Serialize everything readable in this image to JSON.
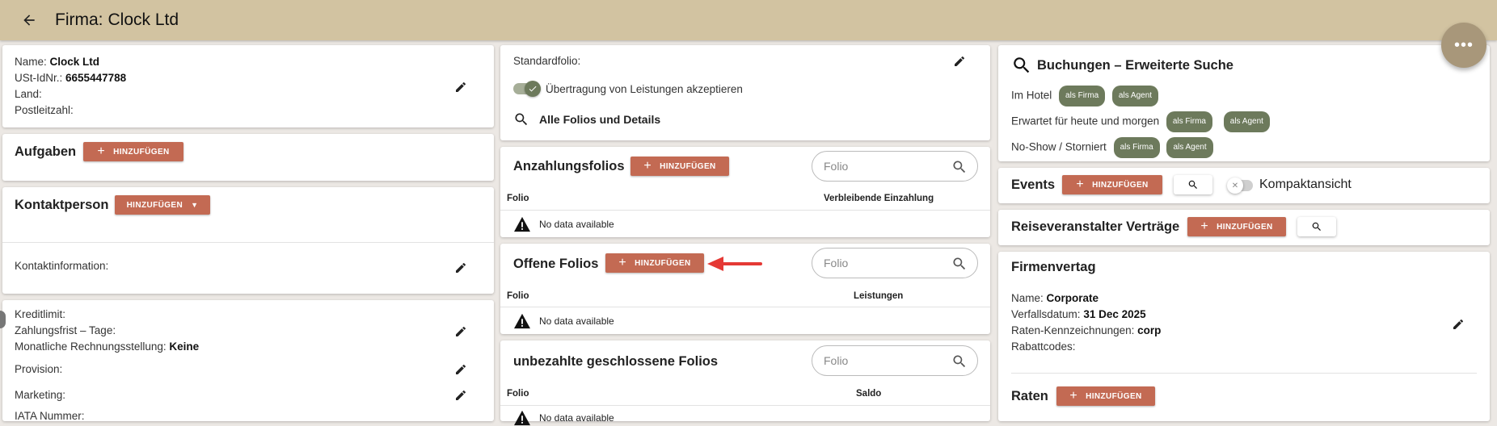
{
  "header": {
    "title_label": "Firma:",
    "title_value": "Clock Ltd"
  },
  "company": {
    "name_label": "Name:",
    "name_value": "Clock Ltd",
    "vat_label": "USt-IdNr.:",
    "vat_value": "6655447788",
    "country_label": "Land:",
    "postal_label": "Postleitzahl:"
  },
  "tasks": {
    "title": "Aufgaben",
    "add_label": "HINZUFÜGEN"
  },
  "contact": {
    "title": "Kontaktperson",
    "add_label": "HINZUFÜGEN",
    "info_label": "Kontaktinformation:"
  },
  "credit": {
    "limit_label": "Kreditlimit:",
    "payment_terms_label": "Zahlungsfrist – Tage:",
    "monthly_billing_label": "Monatliche Rechnungsstellung:",
    "monthly_billing_value": "Keine",
    "commission_label": "Provision:",
    "marketing_label": "Marketing:",
    "iata_label": "IATA Nummer:"
  },
  "standard": {
    "folio_label": "Standardfolio:",
    "toggle_label": "Übertragung von Leistungen akzeptieren",
    "toggle_on": true,
    "all_folios_label": "Alle Folios und Details"
  },
  "deposit": {
    "title": "Anzahlungsfolios",
    "add_label": "HINZUFÜGEN",
    "search_placeholder": "Folio",
    "col1": "Folio",
    "col2": "Verbleibende Einzahlung",
    "empty": "No data available"
  },
  "open_folios": {
    "title": "Offene Folios",
    "add_label": "HINZUFÜGEN",
    "search_placeholder": "Folio",
    "col1": "Folio",
    "col2": "Leistungen",
    "empty": "No data available"
  },
  "unpaid": {
    "title": "unbezahlte geschlossene Folios",
    "search_placeholder": "Folio",
    "col1": "Folio",
    "col2": "Saldo",
    "empty": "No data available"
  },
  "bookings": {
    "title": "Buchungen – Erweiterte Suche",
    "rows": [
      {
        "label": "Im Hotel",
        "chip1": "als Firma",
        "chip2": "als Agent"
      },
      {
        "label": "Erwartet für heute und morgen",
        "chip1": "als Firma",
        "chip2": "als Agent"
      },
      {
        "label": "No-Show / Storniert",
        "chip1": "als Firma",
        "chip2": "als Agent"
      }
    ]
  },
  "events": {
    "title": "Events",
    "add_label": "HINZUFÜGEN",
    "compact_label": "Kompaktansicht",
    "compact_on": false
  },
  "tour": {
    "title": "Reiseveranstalter Verträge",
    "add_label": "HINZUFÜGEN"
  },
  "contract": {
    "title": "Firmenvertag",
    "name_label": "Name:",
    "name_value": "Corporate",
    "expiry_label": "Verfallsdatum:",
    "expiry_value": "31 Dec 2025",
    "rate_codes_label": "Raten-Kennzeichnungen:",
    "rate_codes_value": "corp",
    "discount_label": "Rabattcodes:"
  },
  "rates": {
    "title": "Raten",
    "add_label": "HINZUFÜGEN"
  },
  "colors": {
    "header": "#d2c3a1",
    "accent": "#c36a53",
    "chip": "#6d7a5c",
    "arrow": "#e53935"
  }
}
